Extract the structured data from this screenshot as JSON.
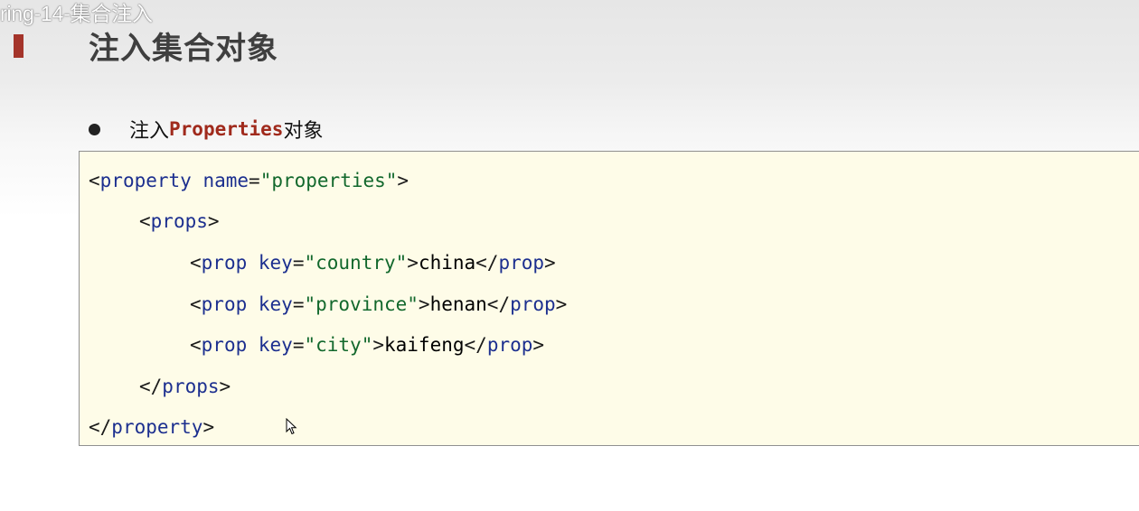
{
  "window": {
    "title": "ring-14-集合注入"
  },
  "slide": {
    "accent_color": "#a4342a",
    "heading": "注入集合对象",
    "bullet": {
      "prefix": "注入",
      "keyword": "Properties",
      "suffix": "对象"
    }
  },
  "code": {
    "lines": [
      {
        "open": "<",
        "tag": "property",
        "attr": "name",
        "eq": "=",
        "value": "\"properties\"",
        "close": ">"
      },
      {
        "open": "<",
        "tag": "props",
        "close": ">"
      },
      {
        "open": "<",
        "tag": "prop",
        "attr": "key",
        "eq": "=",
        "value": "\"country\"",
        "close": ">",
        "text": "china",
        "end_open": "</",
        "end_tag": "prop",
        "end_close": ">"
      },
      {
        "open": "<",
        "tag": "prop",
        "attr": "key",
        "eq": "=",
        "value": "\"province\"",
        "close": ">",
        "text": "henan",
        "end_open": "</",
        "end_tag": "prop",
        "end_close": ">"
      },
      {
        "open": "<",
        "tag": "prop",
        "attr": "key",
        "eq": "=",
        "value": "\"city\"",
        "close": ">",
        "text": "kaifeng",
        "end_open": "</",
        "end_tag": "prop",
        "end_close": ">"
      },
      {
        "open": "</",
        "tag": "props",
        "close": ">"
      },
      {
        "open": "</",
        "tag": "property",
        "close": ">"
      }
    ]
  },
  "icons": {
    "cursor": "mouse-pointer-icon"
  }
}
